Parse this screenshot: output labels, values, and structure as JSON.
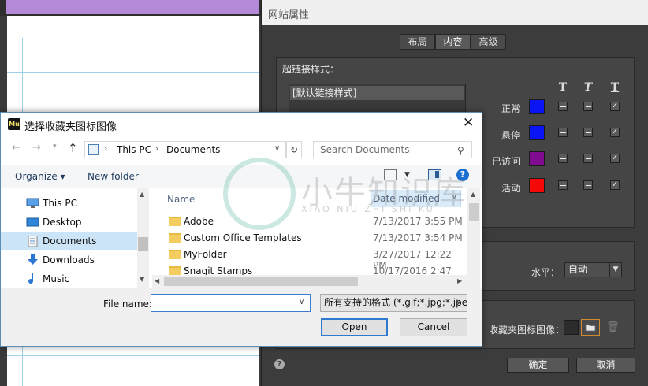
{
  "site_properties": {
    "title": "网站属性",
    "tabs": [
      "布局",
      "内容",
      "高级"
    ],
    "hyperlink_styles_label": "超链接样式：",
    "hyperlink_style_item": "[默认链接样式]",
    "format_headers": [
      "T",
      "T",
      "T"
    ],
    "states": [
      {
        "label": "正常",
        "color": "#0a14f5",
        "bold": "minus",
        "italic": "minus",
        "underline": "check"
      },
      {
        "label": "悬停",
        "color": "#0a14f5",
        "bold": "minus",
        "italic": "minus",
        "underline": "check"
      },
      {
        "label": "已访问",
        "color": "#800a90",
        "bold": "minus",
        "italic": "minus",
        "underline": "check"
      },
      {
        "label": "活动",
        "color": "#f50808",
        "bold": "minus",
        "italic": "minus",
        "underline": "check"
      }
    ],
    "horizontal_label": "水平：",
    "horizontal_value": "自动",
    "favicon_label": "收藏夹图标图像：",
    "ok_label": "确定",
    "cancel_label": "取消",
    "help_glyph": "?"
  },
  "file_dialog": {
    "title": "选择收藏夹图标图像",
    "app_badge": "Mu",
    "breadcrumb": [
      "This PC",
      "Documents"
    ],
    "search_placeholder": "Search Documents",
    "organize_label": "Organize ▾",
    "new_folder_label": "New folder",
    "nav_items": [
      {
        "label": "This PC",
        "icon": "computer-icon"
      },
      {
        "label": "Desktop",
        "icon": "desktop-icon"
      },
      {
        "label": "Documents",
        "icon": "documents-icon",
        "selected": true
      },
      {
        "label": "Downloads",
        "icon": "downloads-icon"
      },
      {
        "label": "Music",
        "icon": "music-icon"
      }
    ],
    "columns": {
      "name": "Name",
      "date": "Date modified"
    },
    "rows": [
      {
        "name": "Adobe",
        "date": "7/13/2017 3:55 PM"
      },
      {
        "name": "Custom Office Templates",
        "date": "7/13/2017 3:54 PM"
      },
      {
        "name": "MyFolder",
        "date": "3/27/2017 12:22 PM"
      },
      {
        "name": "Snagit Stamps",
        "date": "10/17/2016 2:47 PM"
      }
    ],
    "file_name_label": "File name:",
    "file_name_value": "",
    "file_type_value": "所有支持的格式 (*.gif;*.jpg;*.jpeg;*.png)",
    "open_label": "Open",
    "cancel_label": "Cancel"
  },
  "watermark": {
    "title": "小牛知识库",
    "subtitle": "XIAO NIU ZHI SHI KU"
  }
}
